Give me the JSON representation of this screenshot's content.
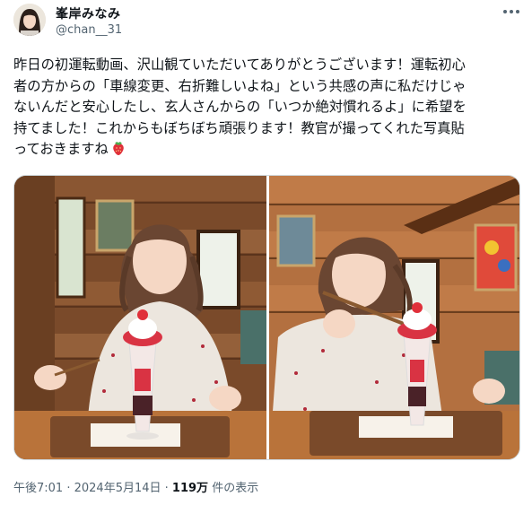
{
  "author": {
    "display_name": "峯岸みなみ",
    "handle": "@chan__31"
  },
  "tweet": {
    "text": "昨日の初運転動画、沢山観ていただいてありがとうございます！運転初心\n者の方からの「車線変更、右折難しいよね」という共感の声に私だけじゃ\nないんだと安心したし、玄人さんからの「いつか絶対慣れるよ」に希望を\n持てました！これからもぼちぼち頑張ります！教官が撮ってくれた写真貼\nっておきますね",
    "emoji": "strawberry-emoji"
  },
  "media": {
    "photos": [
      {
        "subject": "woman-with-strawberry-parfait-smiling"
      },
      {
        "subject": "woman-with-strawberry-parfait-eating"
      }
    ]
  },
  "footer": {
    "time": "午後7:01",
    "separator": " · ",
    "date": "2024年5月14日",
    "views_count": "119万",
    "views_label": " 件の表示"
  },
  "colors": {
    "text_primary": "#0f1419",
    "text_secondary": "#536471",
    "border": "#cfd9de",
    "strawberry": "#e0303a"
  }
}
